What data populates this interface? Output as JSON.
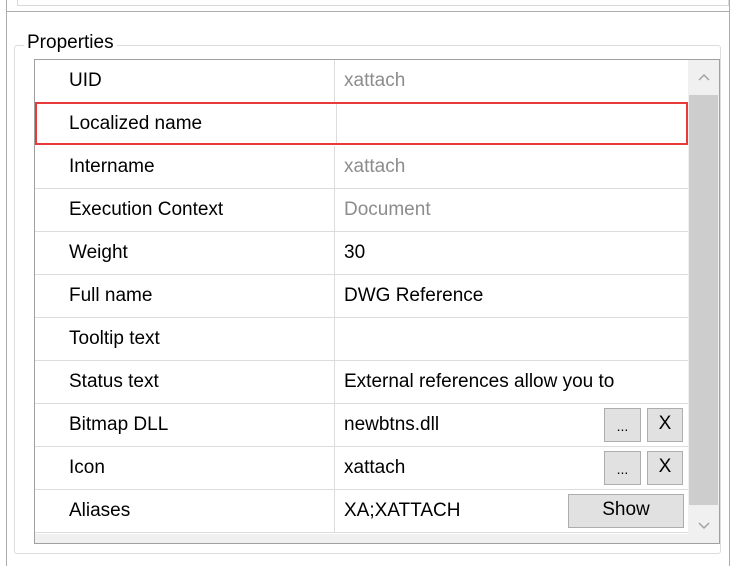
{
  "group": {
    "label": "Properties"
  },
  "properties": [
    {
      "name": "UID",
      "value": "xattach",
      "readonly": true
    },
    {
      "name": "Localized name",
      "value": "",
      "readonly": false,
      "selected": true
    },
    {
      "name": "Intername",
      "value": "xattach",
      "readonly": true
    },
    {
      "name": "Execution Context",
      "value": "Document",
      "readonly": true
    },
    {
      "name": "Weight",
      "value": "30",
      "readonly": false
    },
    {
      "name": "Full name",
      "value": "DWG Reference",
      "readonly": false
    },
    {
      "name": "Tooltip text",
      "value": "",
      "readonly": false
    },
    {
      "name": "Status text",
      "value": "External references allow you to",
      "readonly": false
    },
    {
      "name": "Bitmap DLL",
      "value": "newbtns.dll",
      "readonly": false,
      "browse_label": "...",
      "clear_label": "X"
    },
    {
      "name": "Icon",
      "value": "xattach",
      "readonly": false,
      "browse_label": "...",
      "clear_label": "X"
    },
    {
      "name": "Aliases",
      "value": "XA;XATTACH",
      "readonly": false,
      "show_label": "Show"
    }
  ],
  "colors": {
    "selection_border": "#e83a3a",
    "readonly_text": "#8c8c8c",
    "grid_line": "#dcdcdc"
  },
  "scrollbar": {
    "up_icon": "chevron-up-icon",
    "down_icon": "chevron-down-icon"
  }
}
